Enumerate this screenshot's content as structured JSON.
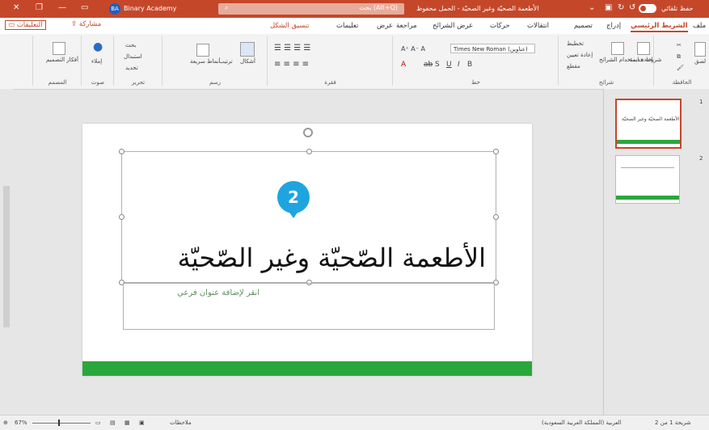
{
  "titlebar": {
    "account_initials": "BA",
    "account_name": "Binary Academy",
    "search_label": "بحث (Alt+Q)",
    "document_title": "الأطعمة الصحيّة وغير الصحيّة - الحمل محفوظ",
    "autosave_label": "حفظ تلقائي",
    "close_glyph": "✕",
    "restore_glyph": "❐",
    "minimize_glyph": "—"
  },
  "tabs": [
    "ملف",
    "الشريط الرئيسي",
    "إدراج",
    "تصميم",
    "انتقالات",
    "حركات",
    "عرض الشرائح",
    "مراجعة",
    "عرض",
    "تعليمات",
    "تنسيق الشكل"
  ],
  "share_label": "مشاركة",
  "comments_label": "التعليقات",
  "ribbon": {
    "groups": [
      "الحافظة",
      "شرائح",
      "خط",
      "فقرة",
      "رسم",
      "تحرير",
      "صوت",
      "المصمم"
    ],
    "buttons": {
      "paste": "لصق",
      "new_slide": "شريحة جديدة",
      "reuse_slides": "إعادة استخدام الشرائح",
      "layout": "تخطيط",
      "reset": "إعادة تعيين",
      "section": "مقطع",
      "shapes": "أشكال",
      "arrange": "ترتيب",
      "quick_styles": "أنماط سريعة",
      "find": "بحث",
      "replace": "استبدال",
      "select": "تحديد",
      "dictate": "إملاء",
      "designer": "أفكار التصميم"
    },
    "font_name": "Times New Roman (عناوين)"
  },
  "thumbnails": [
    {
      "number": "1",
      "title": "الأطعمة الصحيّة وغير الصحيّة"
    },
    {
      "number": "2",
      "title": ""
    }
  ],
  "slide": {
    "title": "الأطعمة الصّحيّة وغير الصّحيّة",
    "subtitle_placeholder": "انقر لإضافة عنوان فرعي",
    "callout_number": "2"
  },
  "statusbar": {
    "slide_position": "شريحة 1 من 2",
    "language": "العربية (المملكة العربية السعودية)",
    "notes_label": "ملاحظات",
    "zoom": "67%"
  },
  "colors": {
    "accent": "#c5472a",
    "green_bar": "#2aa73b",
    "callout": "#1ea5e0"
  }
}
